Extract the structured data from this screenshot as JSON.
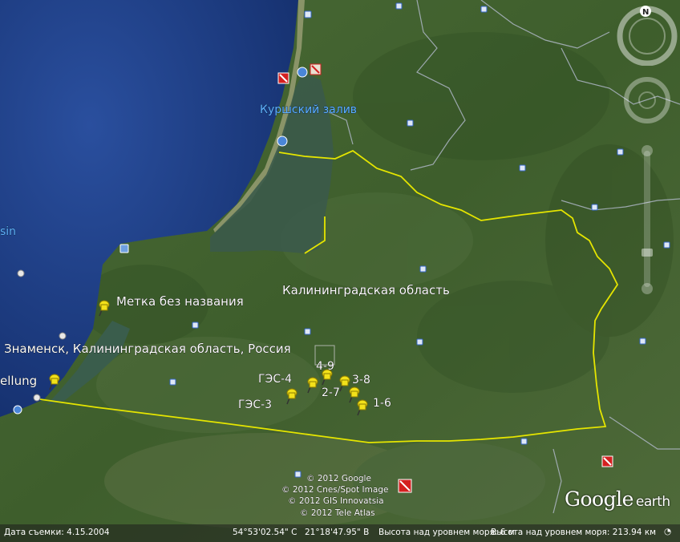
{
  "map": {
    "labels": {
      "lagoon": "Куршский залив",
      "region": "Калининградская область",
      "unnamed_mark": "Метка без названия",
      "znamensk": "Знаменск, Калининградская область, Россия",
      "edge_left_top": "sin",
      "edge_left_bottom": "ellung",
      "ges4": "ГЭС-4",
      "ges3": "ГЭС-3",
      "p49": "4-9",
      "p27": "2-7",
      "p38": "3-8",
      "p16": "1-6"
    },
    "copyright": [
      "© 2012 Google",
      "© 2012 Cnes/Spot Image",
      "© 2012 GIS Innovatsia",
      "© 2012 Tele Atlas"
    ],
    "colors": {
      "sea": "#1f3f8a",
      "land": "#3b5a2c",
      "border": "#e8e800",
      "pin": "#f2e11a"
    }
  },
  "logo": {
    "google": "Google",
    "earth": "earth"
  },
  "status": {
    "imagery_date": "Дата съемки: 4.15.2004",
    "lat": "54°53'02.54\" С",
    "lon": "21°18'47.95\" В",
    "elev": "Высота над уровнем моря: 6 м",
    "eye": "Высота над уровнем моря: 213.94 км"
  },
  "nav": {
    "north": "N"
  }
}
